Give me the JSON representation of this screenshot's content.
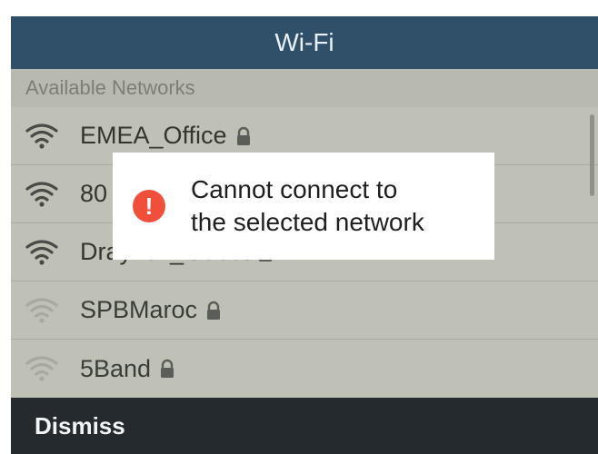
{
  "header": {
    "title": "Wi-Fi"
  },
  "section": {
    "title": "Available Networks"
  },
  "networks": [
    {
      "name": "EMEA_Office",
      "signal": "strong",
      "secured": true
    },
    {
      "name": "80",
      "signal": "strong",
      "secured": false
    },
    {
      "name": "DrayTek_Guest",
      "signal": "strong",
      "secured": true
    },
    {
      "name": "SPBMaroc",
      "signal": "weak",
      "secured": true
    },
    {
      "name": "5Band",
      "signal": "weak",
      "secured": true
    }
  ],
  "dialog": {
    "icon": "alert-icon",
    "line1": "Cannot connect to",
    "line2": "the selected network"
  },
  "softkeys": {
    "dismiss_label": "Dismiss"
  },
  "colors": {
    "titlebar": "#2f5068",
    "alert": "#f04f3a",
    "softkey_bar": "#252a2e"
  }
}
